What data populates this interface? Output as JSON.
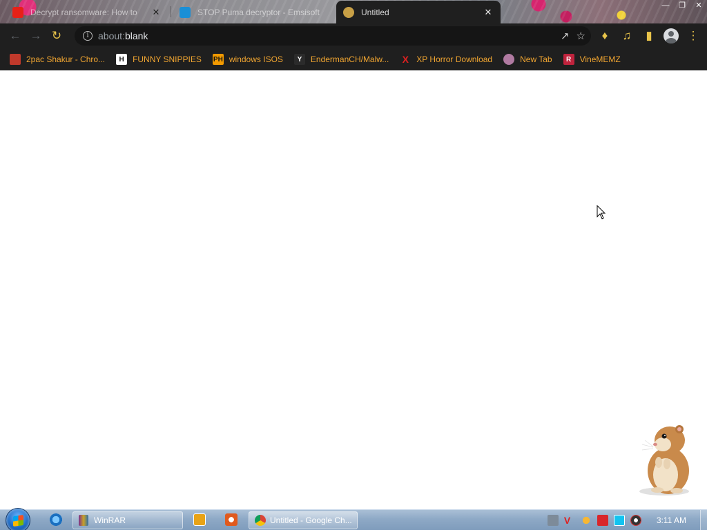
{
  "browser": {
    "tabs": [
      {
        "title": "Decrypt ransomware: How to",
        "state": "inactive",
        "icon": "youtube-icon"
      },
      {
        "title": "STOP Puma decryptor - Emsisoft",
        "state": "inactive",
        "icon": "shield-icon"
      },
      {
        "title": "Untitled",
        "state": "active",
        "icon": "blank-page-icon"
      }
    ],
    "close_glyph": "✕",
    "address_bar": {
      "scheme": "about:",
      "path": "blank"
    },
    "nav_icons": [
      "back-icon",
      "forward-icon",
      "reload-icon"
    ],
    "toolbar_icons": [
      "share-icon",
      "star-icon",
      "extensions-icon",
      "media-icon",
      "side-panel-icon",
      "profile-icon",
      "menu-icon"
    ]
  },
  "bookmarks": [
    {
      "label": "2pac Shakur - Chro...",
      "icon": "red-tab-icon",
      "color": "#c0392b"
    },
    {
      "label": "FUNNY SNIPPIES",
      "icon": "h-letter-icon",
      "color": "#ffffff"
    },
    {
      "label": "windows ISOS",
      "icon": "ph-logo-icon",
      "color": "#f29a00"
    },
    {
      "label": "EndermanCH/Malw...",
      "icon": "y-letter-icon",
      "color": "#2b2b2b"
    },
    {
      "label": "XP Horror Download",
      "icon": "x-letter-icon",
      "color": "#e02020"
    },
    {
      "label": "New Tab",
      "icon": "globe-icon",
      "color": "#b07aa1"
    },
    {
      "label": "VineMEMZ",
      "icon": "r-letter-icon",
      "color": "#c0233d"
    }
  ],
  "taskbar": {
    "items": [
      {
        "label": "WinRAR",
        "icon": "winrar-icon"
      },
      {
        "label": "Untitled - Google Ch...",
        "icon": "chrome-icon"
      }
    ],
    "pinned": [
      "internet-explorer-icon",
      "media-player-icon",
      "generic-app-icon"
    ],
    "tray_icons": [
      "tray-app-1-icon",
      "tray-v-icon",
      "tray-search-icon",
      "tray-flag-icon",
      "tray-network-icon",
      "tray-circle-icon"
    ],
    "clock": "3:11 AM"
  },
  "colors": {
    "bookmark_text": "#f0a531",
    "toolbar_bg": "#1f1f1f",
    "page_bg": "#ffffff"
  }
}
